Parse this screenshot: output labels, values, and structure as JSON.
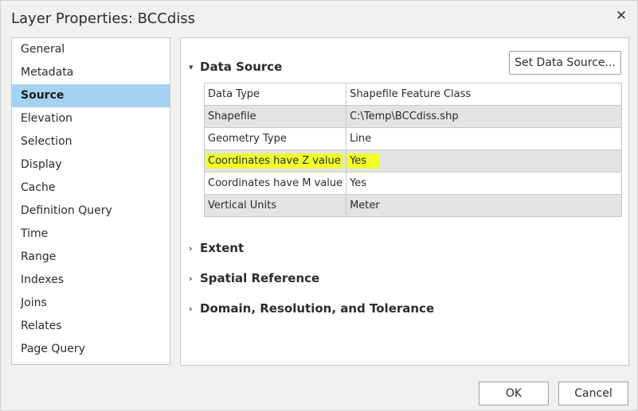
{
  "window": {
    "title": "Layer Properties: BCCdiss",
    "close_glyph": "✕"
  },
  "sidebar": {
    "items": [
      {
        "label": "General"
      },
      {
        "label": "Metadata"
      },
      {
        "label": "Source",
        "selected": true
      },
      {
        "label": "Elevation"
      },
      {
        "label": "Selection"
      },
      {
        "label": "Display"
      },
      {
        "label": "Cache"
      },
      {
        "label": "Definition Query"
      },
      {
        "label": "Time"
      },
      {
        "label": "Range"
      },
      {
        "label": "Indexes"
      },
      {
        "label": "Joins"
      },
      {
        "label": "Relates"
      },
      {
        "label": "Page Query"
      }
    ]
  },
  "main": {
    "data_source": {
      "heading": "Data Source",
      "expanded": true,
      "set_button": "Set Data Source...",
      "rows": [
        {
          "key": "Data Type",
          "value": "Shapefile Feature Class"
        },
        {
          "key": "Shapefile",
          "value": "C:\\Temp\\BCCdiss.shp"
        },
        {
          "key": "Geometry Type",
          "value": "Line"
        },
        {
          "key": "Coordinates have Z value",
          "value": "Yes",
          "highlighted": true
        },
        {
          "key": "Coordinates have M value",
          "value": "Yes"
        },
        {
          "key": "Vertical Units",
          "value": "Meter"
        }
      ]
    },
    "sections": [
      {
        "heading": "Extent",
        "expanded": false
      },
      {
        "heading": "Spatial Reference",
        "expanded": false
      },
      {
        "heading": "Domain, Resolution, and Tolerance",
        "expanded": false
      }
    ]
  },
  "footer": {
    "ok_label": "OK",
    "cancel_label": "Cancel"
  },
  "colors": {
    "selected_bg": "#a6d2f2",
    "highlight": "#f3ff2a",
    "alt_row": "#e3e3e3"
  }
}
